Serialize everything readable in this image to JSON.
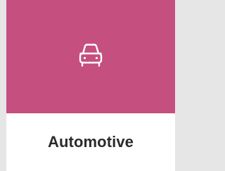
{
  "category_card": {
    "label": "Automotive",
    "icon": "car-icon",
    "colors": {
      "media_background": "#c54f7e",
      "icon_stroke": "#ffffff",
      "label_text": "#2b2b2b",
      "card_background": "#ffffff",
      "page_background": "#e6e6e6"
    }
  }
}
